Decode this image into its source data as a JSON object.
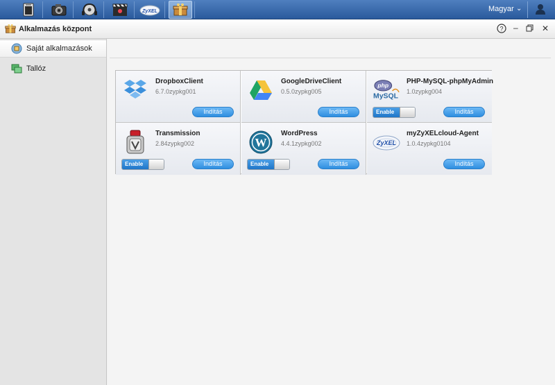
{
  "taskbar": {
    "apps": [
      {
        "icon": "file-browser-icon"
      },
      {
        "icon": "photo-icon"
      },
      {
        "icon": "music-icon"
      },
      {
        "icon": "video-icon"
      },
      {
        "icon": "zyxel-cloud-icon",
        "label": "ZyXEL"
      },
      {
        "icon": "app-center-icon"
      }
    ],
    "language": "Magyar",
    "user_icon": "user-icon"
  },
  "window": {
    "title": "Alkalmazás központ",
    "icon": "app-center-icon"
  },
  "sidebar": {
    "items": [
      {
        "label": "Saját alkalmazások",
        "icon": "my-apps-icon",
        "selected": true
      },
      {
        "label": "Tallóz",
        "icon": "browse-icon",
        "selected": false
      }
    ]
  },
  "apps": [
    {
      "name": "DropboxClient",
      "version": "6.7.0zypkg001",
      "start_label": "Indítás",
      "icon": "dropbox-icon",
      "toggle": null
    },
    {
      "name": "GoogleDriveClient",
      "version": "0.5.0zypkg005",
      "start_label": "Indítás",
      "icon": "google-drive-icon",
      "toggle": null
    },
    {
      "name": "PHP-MySQL-phpMyAdmin",
      "version": "1.0zypkg004",
      "start_label": "Indítás",
      "icon": "php-mysql-icon",
      "toggle": "Enable"
    },
    {
      "name": "Transmission",
      "version": "2.84zypkg002",
      "start_label": "Indítás",
      "icon": "transmission-icon",
      "toggle": "Enable"
    },
    {
      "name": "WordPress",
      "version": "4.4.1zypkg002",
      "start_label": "Indítás",
      "icon": "wordpress-icon",
      "toggle": "Enable"
    },
    {
      "name": "myZyXELcloud-Agent",
      "version": "1.0.4zypkg0104",
      "start_label": "Indítás",
      "icon": "zyxel-cloud-icon",
      "toggle": null
    }
  ],
  "icon_labels": {
    "php": "php",
    "mysql": "MySQL",
    "zyxel": "ZyXEL"
  },
  "colors": {
    "taskbar": "#2a5a9c",
    "button": "#2f8ee0",
    "toggle_on": "#1f76c8"
  }
}
